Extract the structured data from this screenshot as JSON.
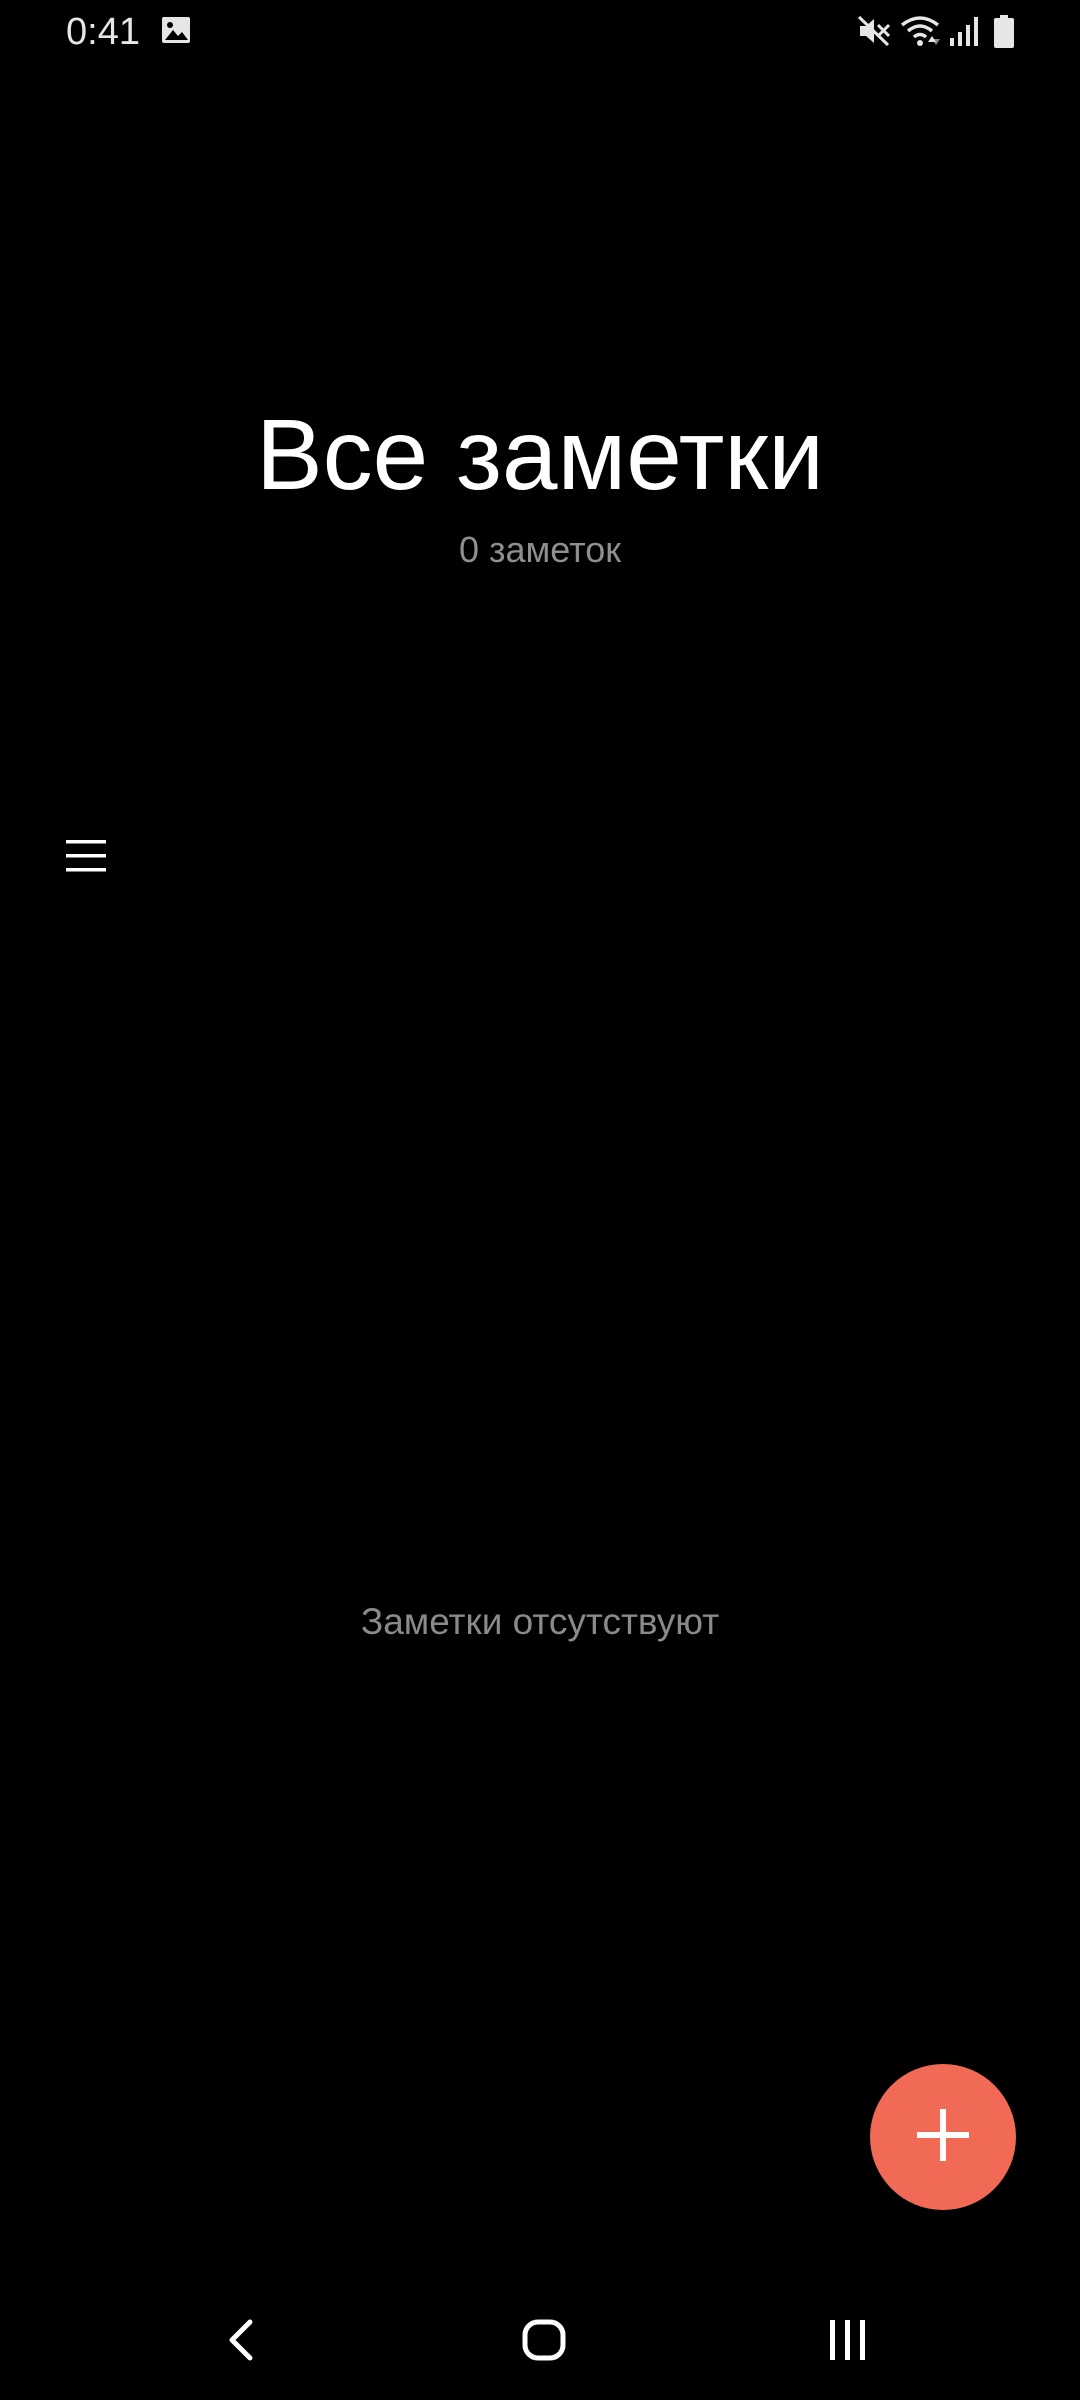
{
  "status_bar": {
    "time": "0:41",
    "icons": [
      "gallery-icon",
      "mute-icon",
      "wifi-icon",
      "signal-icon",
      "battery-icon"
    ]
  },
  "header": {
    "title": "Все заметки",
    "subtitle": "0 заметок"
  },
  "menu": {
    "icon": "hamburger-menu-icon"
  },
  "empty_state": {
    "text": "Заметки отсутствуют"
  },
  "fab": {
    "icon": "plus-icon",
    "color": "#f06a55"
  },
  "navigation": {
    "buttons": [
      "back-icon",
      "home-icon",
      "recents-icon"
    ]
  },
  "colors": {
    "background": "#000000",
    "title": "#ffffff",
    "secondary_text": "#8f8f8f",
    "accent": "#f06a55"
  }
}
